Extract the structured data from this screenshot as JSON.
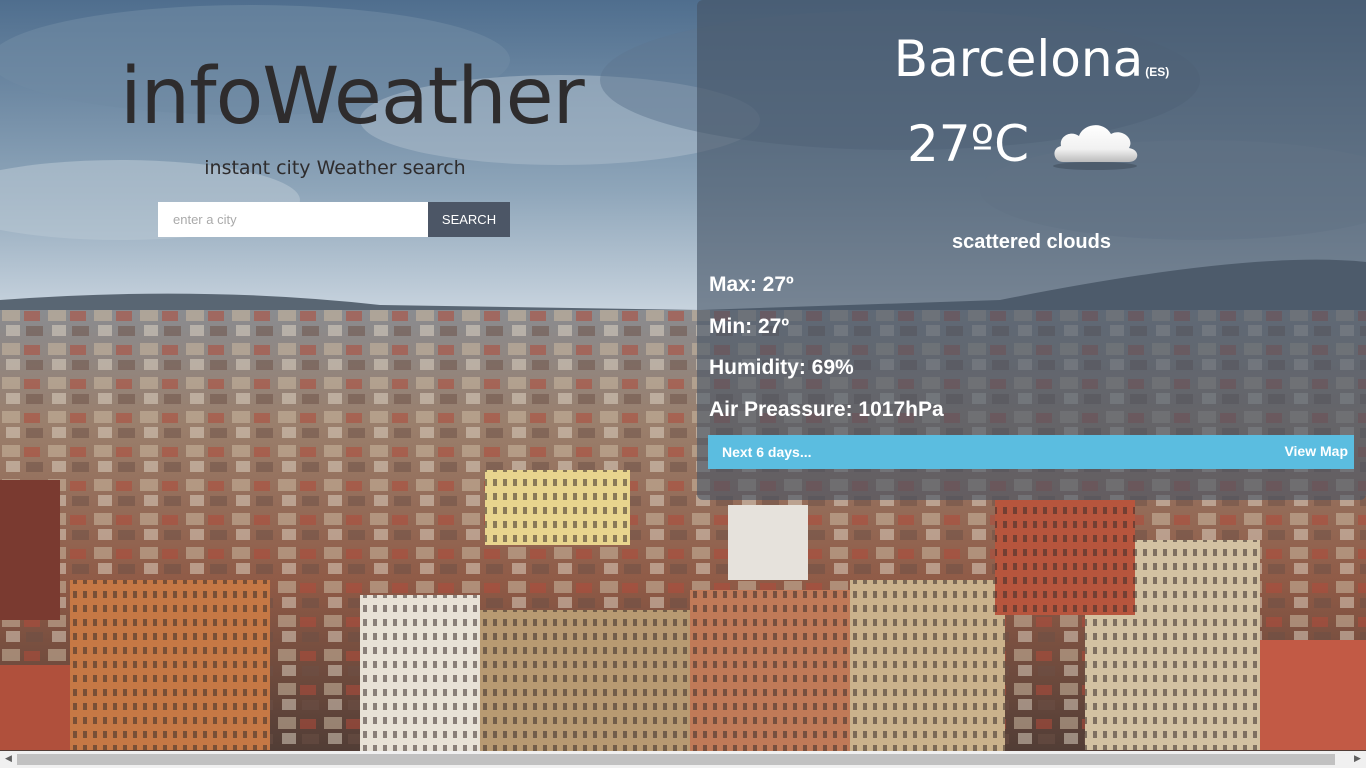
{
  "app": {
    "logo": "infoWeather",
    "tagline": "instant city Weather search"
  },
  "search": {
    "placeholder": "enter a city",
    "value": "",
    "button_label": "SEARCH"
  },
  "weather": {
    "city": "Barcelona",
    "country": "(ES)",
    "temperature": "27ºC",
    "icon": "cloud-icon",
    "description": "scattered clouds",
    "stats": [
      {
        "label": "Max: 27º"
      },
      {
        "label": "Min: 27º"
      },
      {
        "label": "Humidity: 69%"
      },
      {
        "label": "Air Preassure: 1017hPa"
      }
    ],
    "forecast_link": "Next 6 days...",
    "map_link": "View Map"
  },
  "colors": {
    "search_button": "#4c5666",
    "forecast_bar": "#5bbde0",
    "panel_overlay": "#465466"
  }
}
